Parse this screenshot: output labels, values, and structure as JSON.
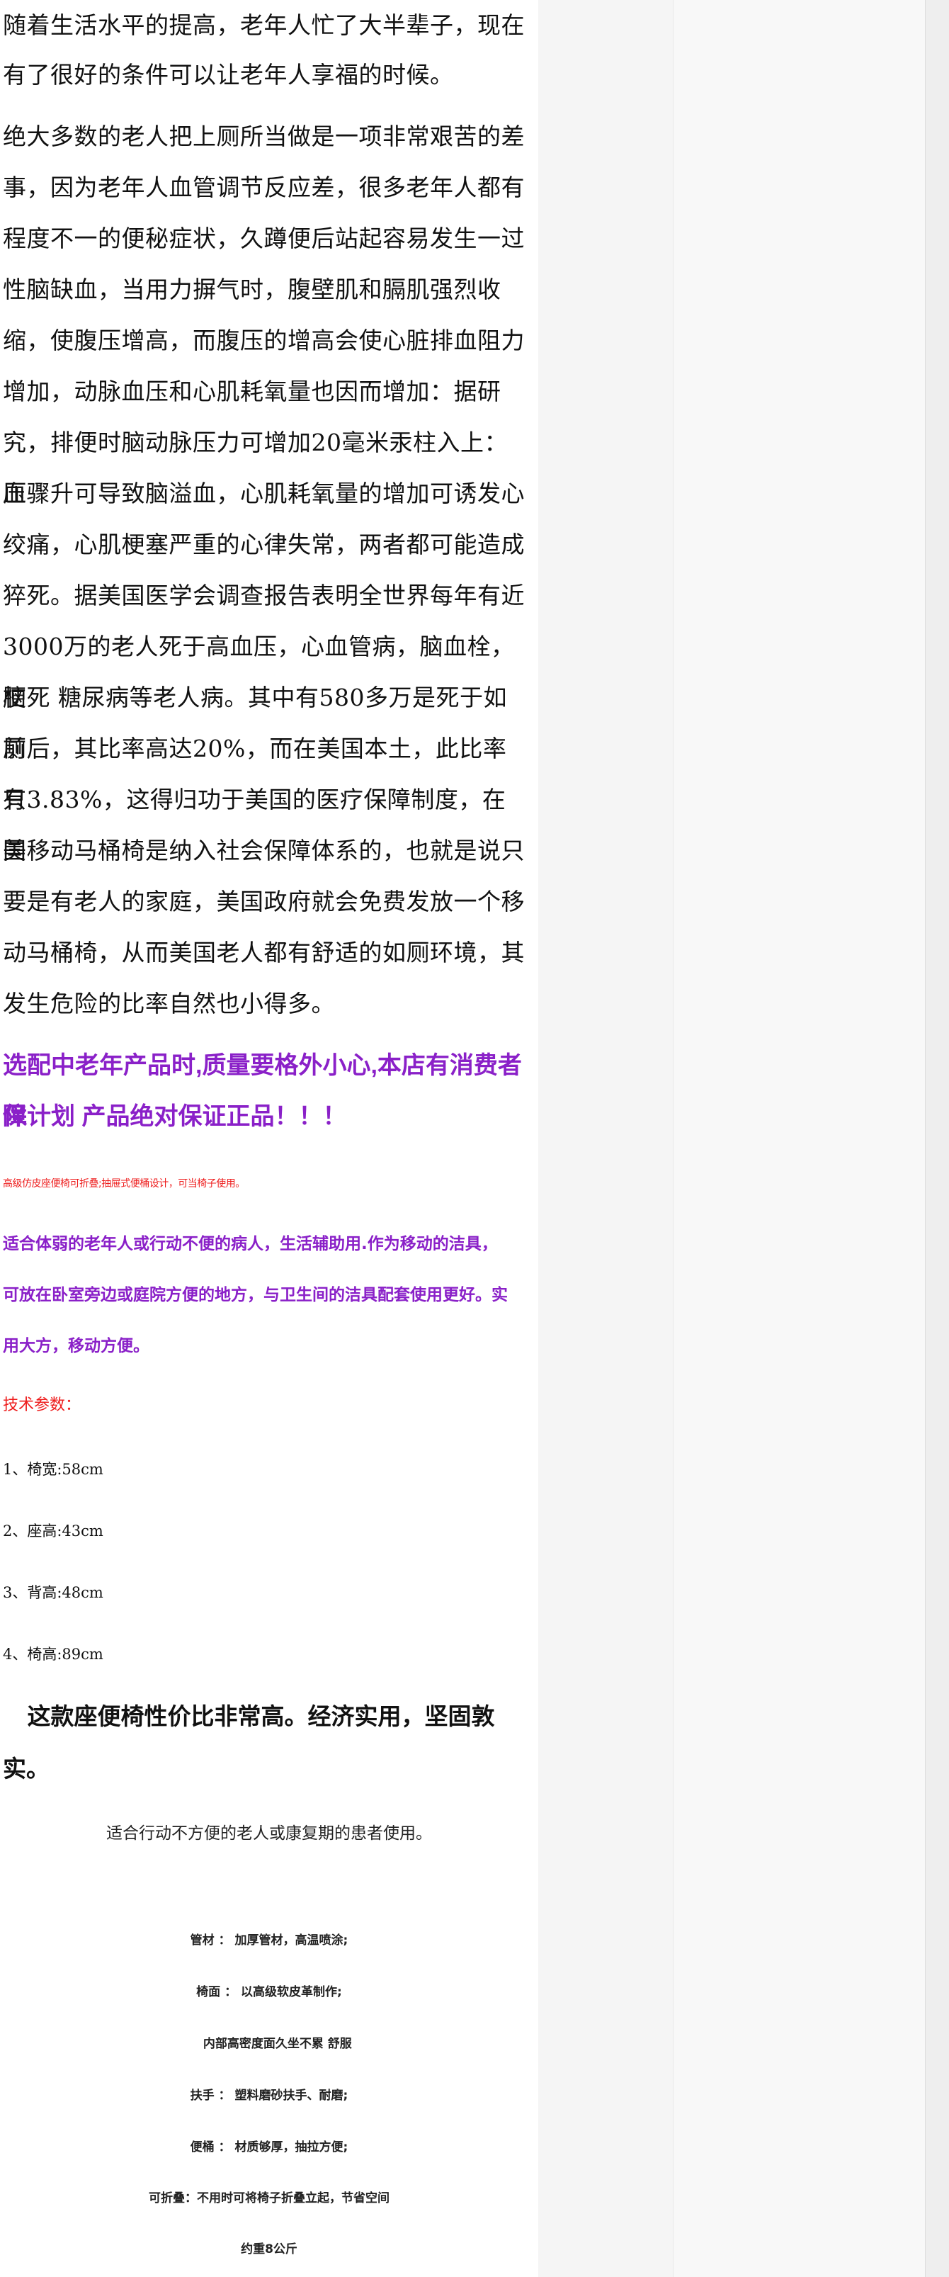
{
  "article": {
    "para1_line1": "随着生活水平的提高，老年人忙了大半辈子，现在",
    "para1_line2": "有了很好的条件可以让老年人享福的时候。",
    "para2": [
      "绝大多数的老人把上厕所当做是一项非常艰苦的差",
      "事，因为老年人血管调节反应差，很多老年人都有",
      "程度不一的便秘症状，久蹲便后站起容易发生一过",
      "性脑缺血，当用力摒气时，腹壁肌和膈肌强烈收",
      "缩，使腹压增高，而腹压的增高会使心脏排血阻力",
      "增加，动脉血压和心肌耗氧量也因而增加：据研",
      "究，排便时脑动脉压力可增加20毫米汞柱入上：血",
      "压骤升可导致脑溢血，心肌耗氧量的增加可诱发心",
      "绞痛，心肌梗塞严重的心律失常，两者都可能造成",
      "猝死。据美国医学会调查报告表明全世界每年有近",
      "3000万的老人死于高血压，心血管病，脑血栓，脑",
      "梗死 糖尿病等老人病。其中有580多万是死于如厕",
      "前后，其比率高达20%，而在美国本土，此比率只",
      "有3.83%，这得归功于美国的医疗保障制度，在美",
      "国移动马桶椅是纳入社会保障体系的，也就是说只",
      "要是有老人的家庭，美国政府就会免费发放一个移",
      "动马桶椅，从而美国老人都有舒适的如厕环境，其",
      "发生危险的比率自然也小得多。"
    ]
  },
  "promo": {
    "line1": "选配中老年产品时,质量要格外小心,本店有消费者保",
    "line2": "障计划 产品绝对保证正品！！！"
  },
  "red_note": "高级仿皮座便椅可折叠;抽屉式便桶设计，可当椅子使用。",
  "purple_para": {
    "line1": "适合体弱的老年人或行动不便的病人，生活辅助用.作为移动的洁具，",
    "line2": "可放在卧室旁边或庭院方便的地方，与卫生间的洁具配套使用更好。实",
    "line3": "用大方，移动方便。"
  },
  "tech_label": "技术参数：",
  "specs": [
    "1、椅宽:58cm",
    "2、座高:43cm",
    "3、背高:48cm",
    "4、椅高:89cm"
  ],
  "headline": {
    "line1": "   这款座便椅性价比非常高。经济实用，坚固敦",
    "line2": "实。"
  },
  "suitable": "适合行动不方便的老人或康复期的患者使用。",
  "features": [
    "管材 ： 加厚管材，高温喷涂;",
    "椅面 ： 以高级软皮革制作;",
    "    内部高密度面久坐不累 舒服",
    "扶手 ： 塑料磨砂扶手、耐磨;",
    "便桶 ： 材质够厚，抽拉方便;",
    "可折叠：不用时可将椅子折叠立起，节省空间",
    "约重8公斤"
  ]
}
